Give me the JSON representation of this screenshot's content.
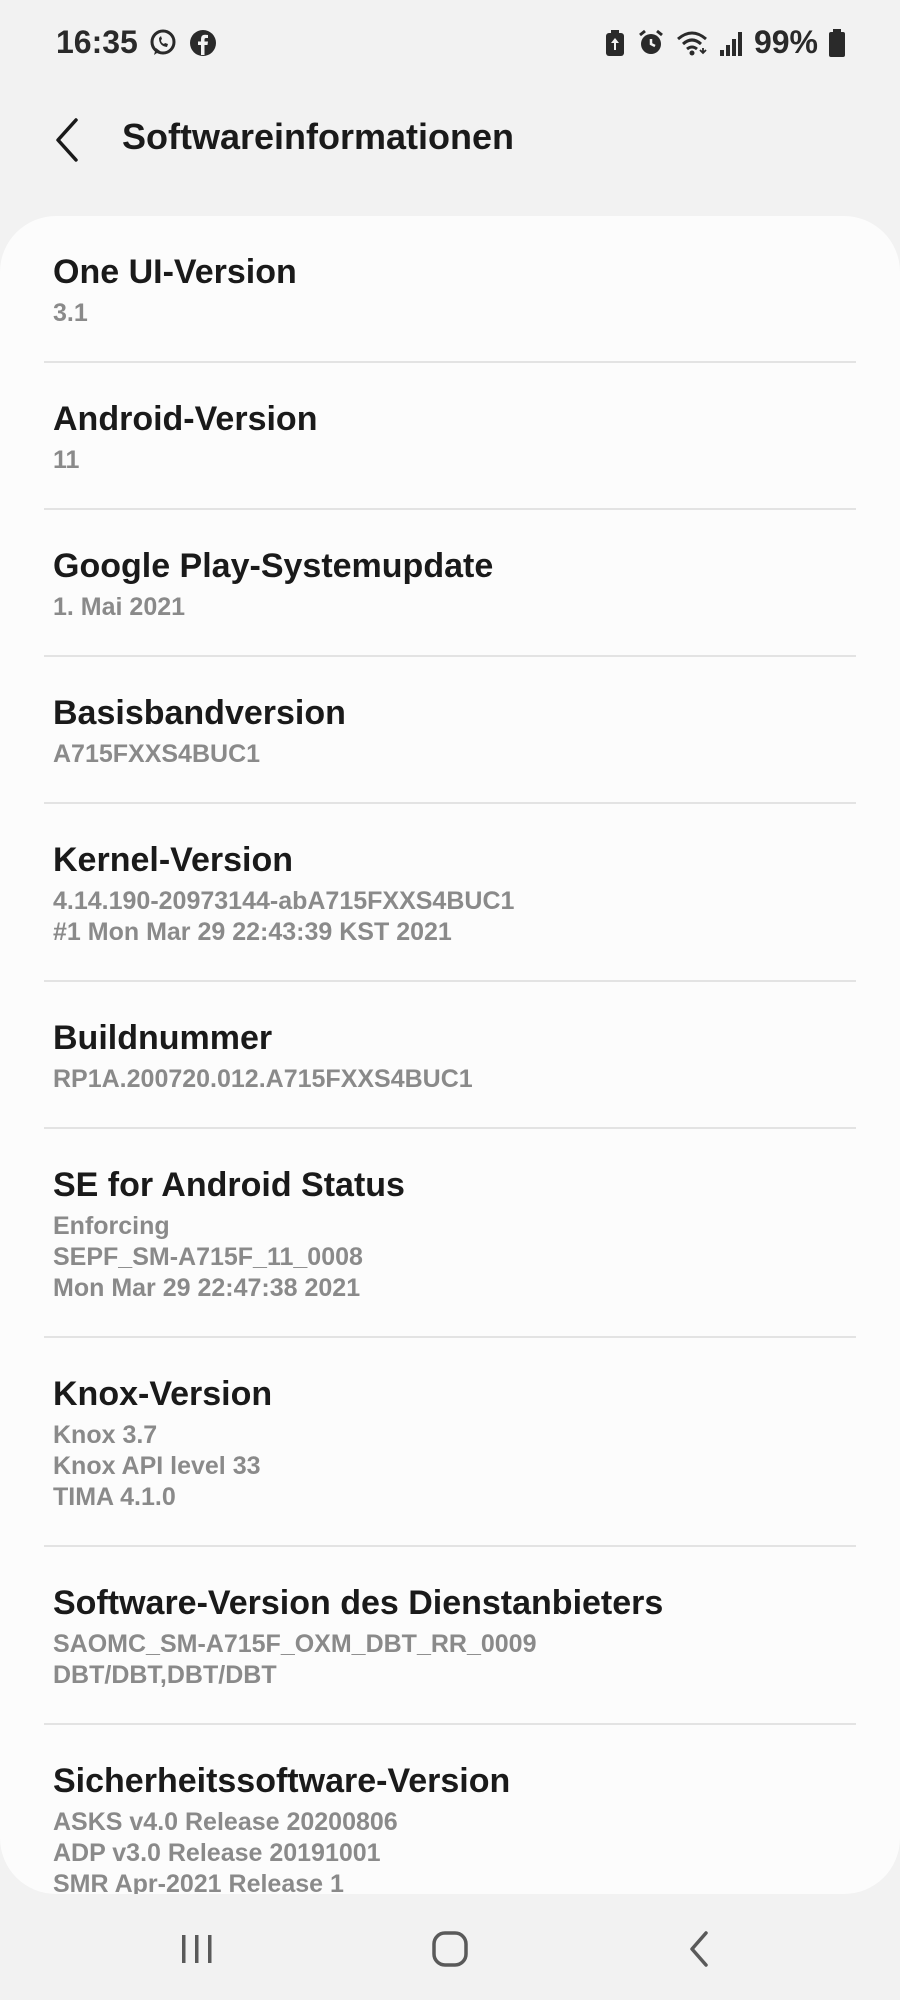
{
  "status_bar": {
    "time": "16:35",
    "battery_text": "99%",
    "left_icons": [
      "whatsapp-icon",
      "facebook-icon"
    ],
    "right_icons": [
      "battery-saver-icon",
      "alarm-icon",
      "wifi-icon",
      "signal-icon",
      "battery-icon"
    ]
  },
  "header": {
    "title": "Softwareinformationen",
    "back_icon": "chevron-left-icon"
  },
  "items": [
    {
      "title": "One UI-Version",
      "lines": [
        "3.1"
      ]
    },
    {
      "title": "Android-Version",
      "lines": [
        "11"
      ]
    },
    {
      "title": "Google Play-Systemupdate",
      "lines": [
        "1. Mai 2021"
      ]
    },
    {
      "title": "Basisbandversion",
      "lines": [
        "A715FXXS4BUC1"
      ]
    },
    {
      "title": "Kernel-Version",
      "lines": [
        "4.14.190-20973144-abA715FXXS4BUC1",
        "#1 Mon Mar 29 22:43:39 KST 2021"
      ]
    },
    {
      "title": "Buildnummer",
      "lines": [
        "RP1A.200720.012.A715FXXS4BUC1"
      ]
    },
    {
      "title": "SE for Android Status",
      "lines": [
        "Enforcing",
        "SEPF_SM-A715F_11_0008",
        "Mon Mar 29 22:47:38 2021"
      ]
    },
    {
      "title": "Knox-Version",
      "lines": [
        "Knox 3.7",
        "Knox API level 33",
        "TIMA 4.1.0"
      ]
    },
    {
      "title": "Software-Version des Dienstanbieters",
      "lines": [
        "SAOMC_SM-A715F_OXM_DBT_RR_0009",
        "DBT/DBT,DBT/DBT"
      ]
    },
    {
      "title": "Sicherheitssoftware-Version",
      "lines": [
        "ASKS v4.0 Release 20200806",
        "ADP v3.0 Release 20191001",
        "SMR Apr-2021 Release 1"
      ]
    }
  ],
  "nav_bar": {
    "icons": [
      "recent-apps-icon",
      "home-icon",
      "back-icon"
    ]
  },
  "colors": {
    "background": "#f2f2f2",
    "card": "#fcfcfc",
    "title_text": "#1a1a1a",
    "secondary_text": "#8a8a8a",
    "divider": "#e3e3e3"
  }
}
